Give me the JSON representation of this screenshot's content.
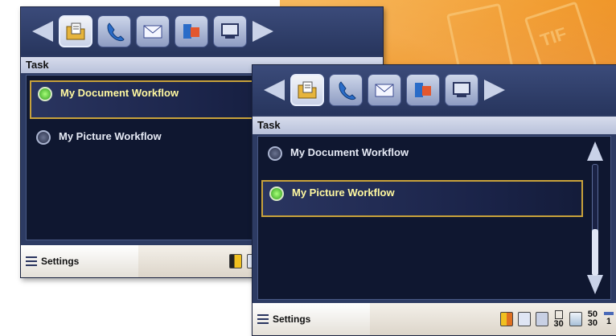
{
  "colors": {
    "panel_bg": "#2d3b63",
    "list_bg": "#0f1730",
    "selected_border": "#c8a23b",
    "selected_text": "#fff8a0",
    "radio_on": "#3fbf2a",
    "art_orange": "#f19a2c"
  },
  "art_icons": [
    "document-icon",
    "tif-file-icon"
  ],
  "toolbar_icons": [
    "back-arrow-icon",
    "folder-document-icon",
    "phone-icon",
    "email-envelope-icon",
    "scan-to-app-icon",
    "monitor-icon",
    "forward-arrow-icon"
  ],
  "back_panel": {
    "task_label": "Task",
    "items": [
      {
        "label": "My Document Workflow",
        "selected": true
      },
      {
        "label": "My Picture Workflow",
        "selected": false
      }
    ],
    "status": {
      "settings_label": "Settings"
    }
  },
  "front_panel": {
    "task_label": "Task",
    "items": [
      {
        "label": "My Document Workflow",
        "selected": false
      },
      {
        "label": "My Picture Workflow",
        "selected": true
      }
    ],
    "scroll_position": 0.0,
    "status": {
      "settings_label": "Settings",
      "page_count": "30",
      "dpi_top": "50",
      "dpi_bottom": "30",
      "copies": "1"
    }
  }
}
